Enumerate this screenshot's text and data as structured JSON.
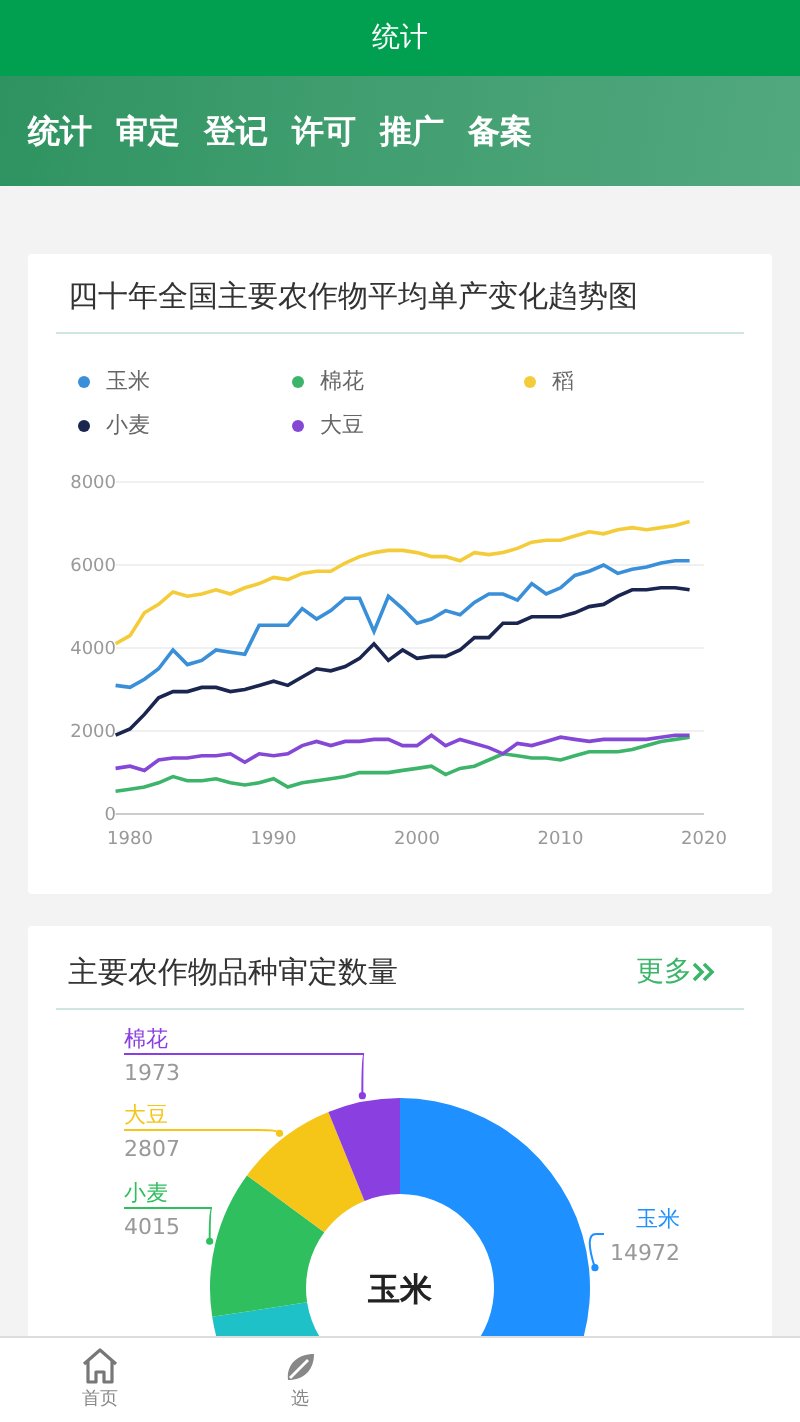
{
  "header": {
    "title": "统计"
  },
  "tabs": [
    {
      "label": "统计"
    },
    {
      "label": "审定"
    },
    {
      "label": "登记"
    },
    {
      "label": "许可"
    },
    {
      "label": "推广"
    },
    {
      "label": "备案"
    }
  ],
  "trend_card": {
    "title": "四十年全国主要农作物平均单产变化趋势图",
    "chart_data": {
      "type": "line",
      "x": [
        1979,
        1980,
        1981,
        1982,
        1983,
        1984,
        1985,
        1986,
        1987,
        1988,
        1989,
        1990,
        1991,
        1992,
        1993,
        1994,
        1995,
        1996,
        1997,
        1998,
        1999,
        2000,
        2001,
        2002,
        2003,
        2004,
        2005,
        2006,
        2007,
        2008,
        2009,
        2010,
        2011,
        2012,
        2013,
        2014,
        2015,
        2016,
        2017,
        2018,
        2019
      ],
      "grid": true,
      "xticks": [
        1980,
        1990,
        2000,
        2010,
        2020
      ],
      "yticks": [
        0,
        2000,
        4000,
        6000,
        8000
      ],
      "ylim": [
        0,
        8000
      ],
      "xlim": [
        1979,
        2020
      ],
      "series": [
        {
          "name": "玉米",
          "color": "#3a8fd9",
          "values": [
            3100,
            3050,
            3250,
            3500,
            3950,
            3600,
            3700,
            3950,
            3900,
            3850,
            4550,
            4550,
            4550,
            4950,
            4700,
            4900,
            5200,
            5200,
            4400,
            5250,
            4950,
            4600,
            4700,
            4900,
            4800,
            5100,
            5300,
            5300,
            5150,
            5550,
            5300,
            5450,
            5750,
            5850,
            6000,
            5800,
            5900,
            5950,
            6050,
            6100,
            6100
          ]
        },
        {
          "name": "棉花",
          "color": "#3cb56a",
          "values": [
            550,
            600,
            650,
            750,
            900,
            800,
            800,
            850,
            750,
            700,
            750,
            850,
            650,
            750,
            800,
            850,
            900,
            1000,
            1000,
            1000,
            1050,
            1100,
            1150,
            950,
            1100,
            1150,
            1300,
            1450,
            1400,
            1350,
            1350,
            1300,
            1400,
            1500,
            1500,
            1500,
            1550,
            1650,
            1750,
            1800,
            1850
          ]
        },
        {
          "name": "稻",
          "color": "#f4cc3a",
          "values": [
            4100,
            4300,
            4850,
            5050,
            5350,
            5250,
            5300,
            5400,
            5300,
            5450,
            5550,
            5700,
            5650,
            5800,
            5850,
            5850,
            6050,
            6200,
            6300,
            6350,
            6350,
            6300,
            6200,
            6200,
            6100,
            6300,
            6250,
            6300,
            6400,
            6550,
            6600,
            6600,
            6700,
            6800,
            6750,
            6850,
            6900,
            6850,
            6900,
            6950,
            7050
          ]
        },
        {
          "name": "小麦",
          "color": "#1a2550",
          "values": [
            1900,
            2050,
            2400,
            2800,
            2950,
            2950,
            3050,
            3050,
            2950,
            3000,
            3100,
            3200,
            3100,
            3300,
            3500,
            3450,
            3550,
            3750,
            4100,
            3700,
            3950,
            3750,
            3800,
            3800,
            3950,
            4250,
            4250,
            4600,
            4600,
            4750,
            4750,
            4750,
            4850,
            5000,
            5050,
            5250,
            5400,
            5400,
            5450,
            5450,
            5400
          ]
        },
        {
          "name": "大豆",
          "color": "#8447d6",
          "values": [
            1100,
            1150,
            1050,
            1300,
            1350,
            1350,
            1400,
            1400,
            1450,
            1250,
            1450,
            1400,
            1450,
            1650,
            1750,
            1650,
            1750,
            1750,
            1800,
            1800,
            1650,
            1650,
            1900,
            1650,
            1800,
            1700,
            1600,
            1450,
            1700,
            1650,
            1750,
            1850,
            1800,
            1750,
            1800,
            1800,
            1800,
            1800,
            1850,
            1900,
            1900
          ]
        }
      ]
    }
  },
  "variety_card": {
    "title": "主要农作物品种审定数量",
    "more_link": "更多",
    "chart_data": {
      "type": "donut",
      "categories": [
        "玉米",
        null,
        "小麦",
        "大豆",
        "棉花"
      ],
      "values": [
        14972,
        8300,
        4015,
        2807,
        1973
      ],
      "colors": [
        "#1e90ff",
        "#1ec1c8",
        "#2fbf5f",
        "#f5c518",
        "#8a3fe0"
      ],
      "value_labels": [
        "14972",
        null,
        "4015",
        "2807",
        "1973"
      ]
    },
    "center_label": "玉米"
  },
  "bottom_nav": [
    {
      "label": "首页",
      "kind": "home"
    },
    {
      "label": "选",
      "kind": "leaf"
    }
  ]
}
